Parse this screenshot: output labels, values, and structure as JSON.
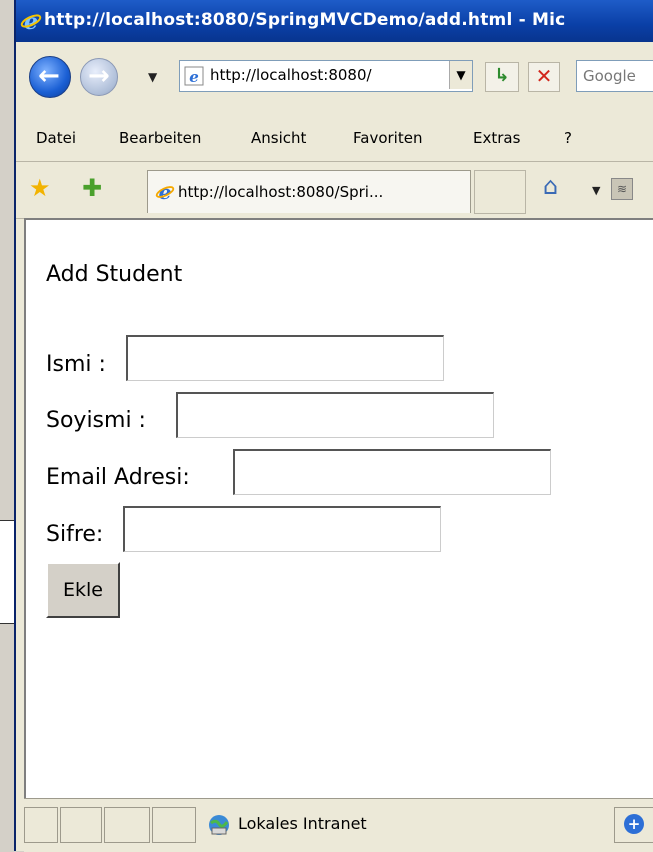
{
  "window": {
    "title": "http://localhost:8080/SpringMVCDemo/add.html - Mic"
  },
  "nav": {
    "address": "http://localhost:8080/",
    "search_placeholder": "Google",
    "go_glyph": "↳",
    "stop_glyph": "✕"
  },
  "menu": {
    "items": [
      "Datei",
      "Bearbeiten",
      "Ansicht",
      "Favoriten",
      "Extras",
      "?"
    ]
  },
  "favorites": {
    "tab_title": "http://localhost:8080/Spri..."
  },
  "page": {
    "heading": "Add Student",
    "fields": [
      {
        "label": "Ismi :",
        "value": ""
      },
      {
        "label": "Soyismi :",
        "value": ""
      },
      {
        "label": "Email Adresi:",
        "value": ""
      },
      {
        "label": "Sifre:",
        "value": ""
      }
    ],
    "submit_label": "Ekle"
  },
  "status": {
    "zone": "Lokales Intranet"
  },
  "colors": {
    "titlebar": "#0a3fa6",
    "window_bg": "#ece9d8",
    "content_bg": "#ffffff"
  }
}
